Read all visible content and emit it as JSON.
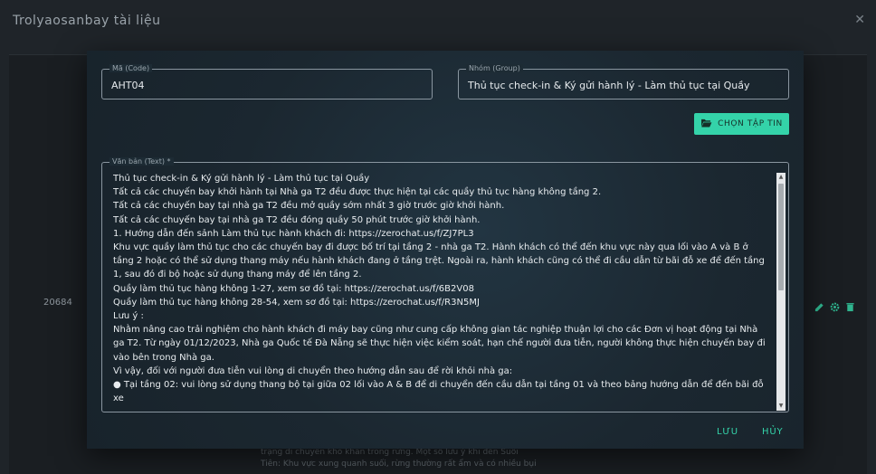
{
  "app": {
    "title": "Trolyaosanbay tài liệu",
    "close_icon": "close-icon"
  },
  "background": {
    "row_id": "20684",
    "row_actions": [
      "edit-icon",
      "settings-icon",
      "delete-icon"
    ],
    "text_lines": [
      "trạng di chuyển khó khăn trong rừng. Một số lưu ý khi đến Suối",
      "Tiên: Khu vực xung quanh suối, rừng thường rất ẩm và có nhiều bụi"
    ]
  },
  "form": {
    "code": {
      "legend": "Mã (Code)",
      "value": "AHT04"
    },
    "group": {
      "legend": "Nhóm (Group)",
      "value": "Thủ tục check-in & Ký gửi hành lý - Làm thủ tục tại Quầy"
    },
    "file_button": {
      "label": "CHỌN TẬP TIN",
      "icon": "folder-open-icon"
    },
    "text": {
      "legend": "Văn bản (Text) *",
      "lines": [
        "Thủ tục check-in & Ký gửi hành lý - Làm thủ tục tại Quầy",
        "Tất cả các chuyến bay khởi hành tại Nhà ga T2 đều được thực hiện tại các quầy thủ tục hàng không tầng 2.",
        "Tất cả các chuyến bay tại nhà ga T2 đều mở quầy sớm nhất 3 giờ trước giờ khởi hành.",
        "Tất cả các chuyến bay tại nhà ga T2 đều đóng quầy 50 phút trước giờ khởi hành.",
        "1. Hướng dẫn đến sảnh Làm thủ tục hành khách đi: https://zerochat.us/f/ZJ7PL3",
        "Khu vực quầy làm thủ tục cho các chuyến bay đi được bố trí tại tầng 2 - nhà ga T2. Hành khách có thể đến khu vực này qua lối vào A và B ở tầng 2 hoặc có thể sử dụng thang máy nếu hành khách đang ở tầng trệt. Ngoài ra, hành khách cũng có thể đi cầu dẫn từ bãi đỗ xe để đến tầng 1, sau đó đi bộ hoặc sử dụng thang máy để lên tầng 2.",
        "Quầy làm thủ tục hàng không 1-27, xem sơ đồ tại: https://zerochat.us/f/6B2V08",
        "Quầy làm thủ tục hàng không 28-54, xem sơ đồ tại: https://zerochat.us/f/R3N5MJ",
        "Lưu ý :",
        "Nhằm nâng cao trải nghiệm cho hành khách đi máy bay cũng như cung cấp không gian tác nghiệp thuận lợi cho các Đơn vị hoạt động tại Nhà ga T2. Từ ngày 01/12/2023, Nhà ga Quốc tế Đà Nẵng sẽ thực hiện việc kiểm soát, hạn chế người đưa tiễn, người không thực hiện chuyến bay đi vào bên trong Nhà ga.",
        "Vì vậy, đối với người đưa tiễn vui lòng di chuyển theo hướng dẫn sau để rời khỏi nhà ga:",
        "● Tại tầng 02: vui lòng sử dụng thang bộ tại giữa 02 lối vào A & B để di chuyển đến cầu dẫn tại tầng 01 và theo bảng hướng dẫn để đến bãi đỗ xe"
      ]
    },
    "save_label": "LƯU",
    "cancel_label": "HỦY"
  },
  "colors": {
    "accent": "#34d3a9",
    "modal_bg": "#1c2a33",
    "page_bg": "#1f2429"
  }
}
